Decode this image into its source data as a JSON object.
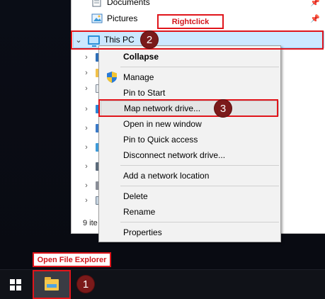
{
  "explorer": {
    "items": [
      {
        "label": "Documents",
        "icon": "documents-icon"
      },
      {
        "label": "Pictures",
        "icon": "pictures-icon"
      }
    ],
    "this_pc_label": "This PC",
    "status_text": "9 ite"
  },
  "context_menu": {
    "items": [
      {
        "label": "Collapse",
        "bold": true
      },
      {
        "label": "Manage",
        "icon": "shield-icon"
      },
      {
        "label": "Pin to Start"
      },
      {
        "label": "Map network drive...",
        "highlighted": true
      },
      {
        "label": "Open in new window"
      },
      {
        "label": "Pin to Quick access"
      },
      {
        "label": "Disconnect network drive..."
      },
      {
        "label": "Add a network location"
      },
      {
        "label": "Delete"
      },
      {
        "label": "Rename"
      },
      {
        "label": "Properties"
      }
    ]
  },
  "annotations": {
    "rightclick_label": "Rightclick",
    "open_explorer_label": "Open File Explorer",
    "step1": "1",
    "step2": "2",
    "step3": "3",
    "color": "#e0151b"
  },
  "taskbar": {
    "start_icon": "windows-logo-icon",
    "explorer_icon": "file-explorer-icon"
  }
}
